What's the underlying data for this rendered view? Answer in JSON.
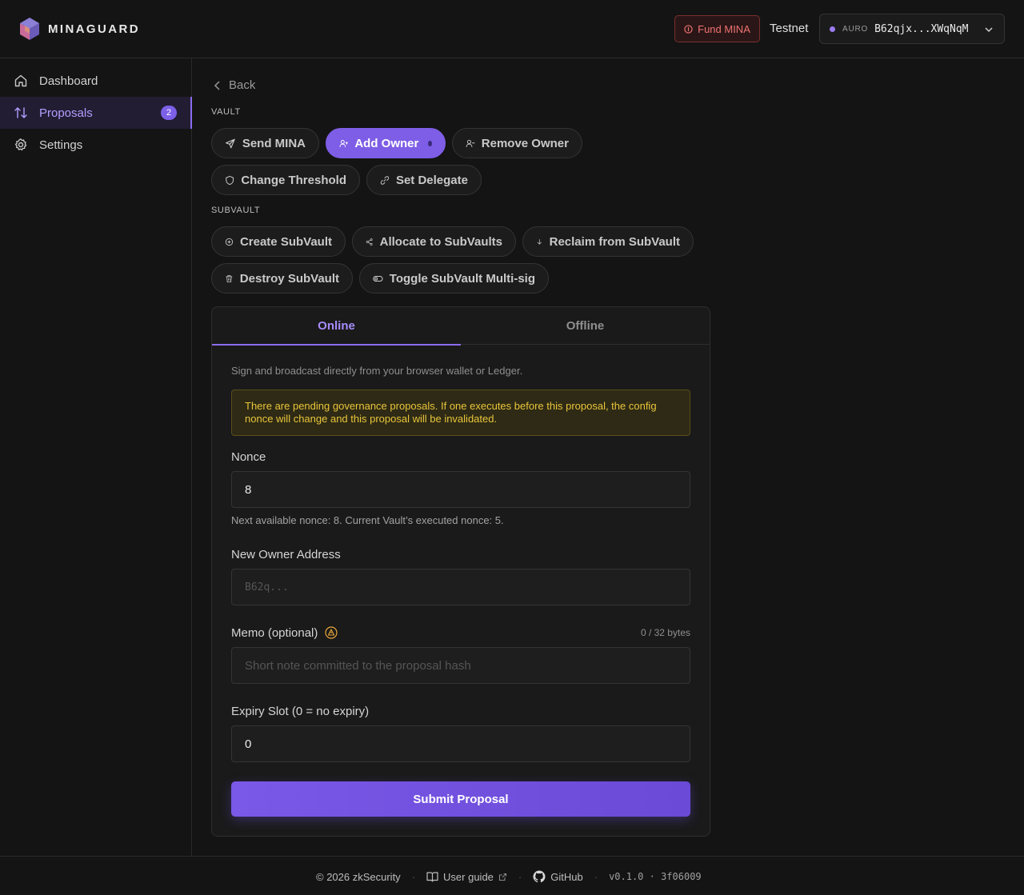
{
  "brand": {
    "name": "MINAGUARD",
    "logo_icon": "cube-logo-icon"
  },
  "header": {
    "fund_label": "Fund MINA",
    "network": "Testnet",
    "wallet": {
      "brand": "AURO",
      "address": "B62qjx...XWqNqM"
    }
  },
  "sidebar": {
    "items": [
      {
        "label": "Dashboard",
        "icon": "home-icon"
      },
      {
        "label": "Proposals",
        "icon": "arrows-updown-icon",
        "badge": "2",
        "active": true
      },
      {
        "label": "Settings",
        "icon": "gear-icon"
      }
    ]
  },
  "main": {
    "back_label": "Back",
    "vault_label": "VAULT",
    "vault_actions": [
      "Send MINA",
      "Add Owner",
      "Remove Owner",
      "Change Threshold",
      "Set Delegate"
    ],
    "subvault_label": "SUBVAULT",
    "subvault_actions": [
      "Create SubVault",
      "Allocate to SubVaults",
      "Reclaim from SubVault",
      "Destroy SubVault",
      "Toggle SubVault Multi-sig"
    ],
    "tabs": [
      "Online",
      "Offline"
    ],
    "hint": "Sign and broadcast directly from your browser wallet or Ledger.",
    "warning": "There are pending governance proposals. If one executes before this proposal, the config nonce will change and this proposal will be invalidated.",
    "nonce": {
      "label": "Nonce",
      "value": "8",
      "help": "Next available nonce: 8. Current Vault’s executed nonce: 5."
    },
    "owner": {
      "label": "New Owner Address",
      "placeholder": "B62q..."
    },
    "memo": {
      "label": "Memo (optional)",
      "count": "0 / 32 bytes",
      "placeholder": "Short note committed to the proposal hash"
    },
    "expiry": {
      "label": "Expiry Slot (0 = no expiry)",
      "value": "0"
    },
    "submit_label": "Submit Proposal"
  },
  "footer": {
    "copyright": "© 2026 zkSecurity",
    "guide": "User guide",
    "github": "GitHub",
    "version": "v0.1.0 · 3f06009"
  },
  "colors": {
    "accent": "#7e5ee6",
    "danger": "#f07272",
    "warning": "#e9c53a",
    "background": "#141414"
  }
}
